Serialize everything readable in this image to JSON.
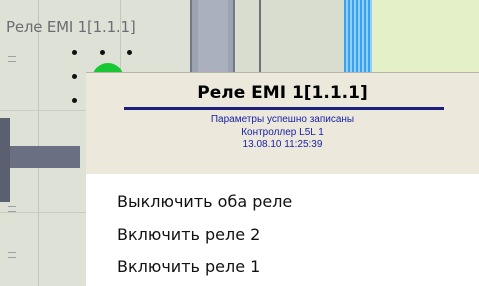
{
  "node": {
    "label": "Реле EMI 1[1.1.1]"
  },
  "info_card": {
    "title": "Реле EMI 1[1.1.1]",
    "status": "Параметры успешно записаны",
    "controller": "Контроллер L5L 1",
    "timestamp": "13.08.10 11:25:39"
  },
  "context_menu": {
    "items": [
      {
        "label": "Выключить оба реле"
      },
      {
        "label": "Включить реле 2"
      },
      {
        "label": "Включить реле 1"
      }
    ]
  },
  "colors": {
    "node_status": "#18c832",
    "info_text": "#1a22a8",
    "rule": "#1a1f7a"
  }
}
